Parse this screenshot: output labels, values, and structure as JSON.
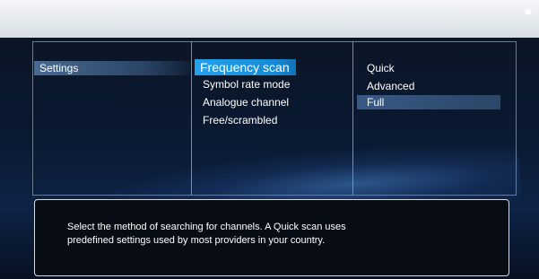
{
  "menu": {
    "left": [
      "Settings"
    ],
    "middle": [
      "Frequency scan",
      "Symbol rate mode",
      "Analogue channel",
      "Free/scrambled"
    ],
    "right": [
      "Quick",
      "Advanced",
      "Full"
    ]
  },
  "info": {
    "description": "Select the method of searching for channels. A Quick scan uses predefined settings used by most providers in your country."
  },
  "colors": {
    "selected": "#22a2ef",
    "highlight": "#4a6a92"
  }
}
